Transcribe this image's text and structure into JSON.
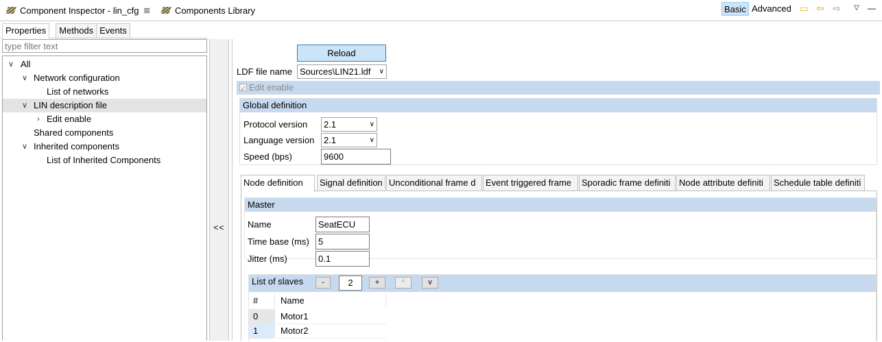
{
  "view_tabs": [
    {
      "label": "Component Inspector - lin_cfg",
      "close": "⊠"
    },
    {
      "label": "Components Library"
    }
  ],
  "toolbar": {
    "basic": "Basic",
    "advanced": "Advanced"
  },
  "left": {
    "tabs": [
      "Properties",
      "Methods",
      "Events"
    ],
    "filter_placeholder": "type filter text",
    "tree": [
      {
        "label": "All",
        "expanded": true
      },
      {
        "label": "Network configuration",
        "expanded": true
      },
      {
        "label": "List of networks"
      },
      {
        "label": "LIN description file",
        "expanded": true,
        "selected": true
      },
      {
        "label": "Edit enable",
        "expanded": false
      },
      {
        "label": "Shared components"
      },
      {
        "label": "Inherited components",
        "expanded": true
      },
      {
        "label": "List of Inherited Components"
      }
    ]
  },
  "splitter": {
    "collapse": "<<"
  },
  "right": {
    "reload": "Reload",
    "ldf_label": "LDF file name",
    "ldf_value": "Sources\\LIN21.ldf",
    "edit_enable": "Edit enable",
    "global": {
      "title": "Global definition",
      "protocol_label": "Protocol version",
      "protocol_value": "2.1",
      "language_label": "Language version",
      "language_value": "2.1",
      "speed_label": "Speed (bps)",
      "speed_value": "9600"
    },
    "tabs": [
      "Node definition",
      "Signal definition",
      "Unconditional frame d",
      "Event triggered frame",
      "Sporadic frame definiti",
      "Node attribute definiti",
      "Schedule table definiti"
    ],
    "master": {
      "title": "Master",
      "name_label": "Name",
      "name_value": "SeatECU",
      "timebase_label": "Time base (ms)",
      "timebase_value": "5",
      "jitter_label": "Jitter (ms)",
      "jitter_value": "0.1"
    },
    "slaves": {
      "title": "List of slaves",
      "minus": "-",
      "count": "2",
      "plus": "+",
      "up": "^",
      "down": "v",
      "columns": [
        "#",
        "Name"
      ],
      "rows": [
        {
          "idx": "0",
          "name": "Motor1"
        },
        {
          "idx": "1",
          "name": "Motor2"
        }
      ]
    }
  }
}
